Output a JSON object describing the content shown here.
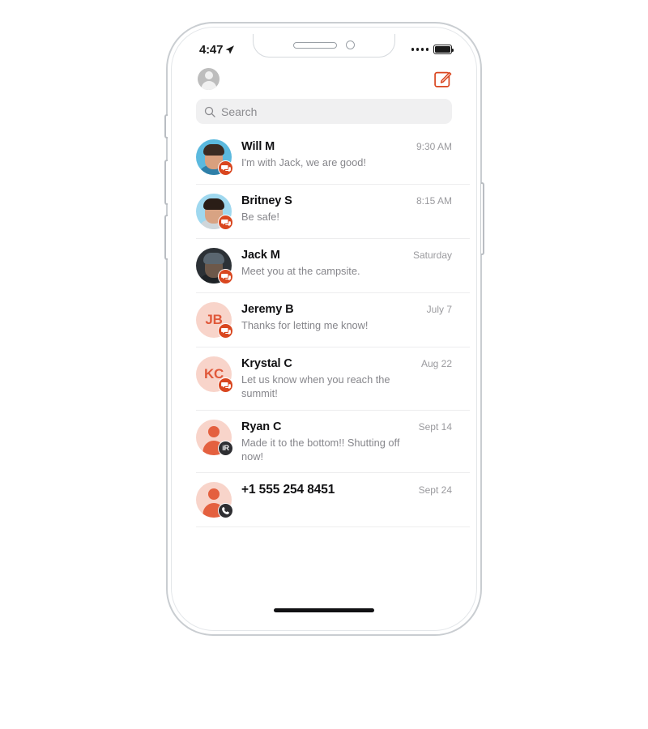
{
  "status_bar": {
    "time": "4:47",
    "location_icon": "location-arrow-icon",
    "signal_icon": "signal-dots-icon",
    "battery_icon": "battery-full-icon"
  },
  "header": {
    "profile_avatar": "profile-avatar-icon",
    "compose_icon": "compose-pencil-icon",
    "accent_color": "#d9461f"
  },
  "search": {
    "placeholder": "Search",
    "value": "",
    "icon": "search-icon"
  },
  "conversations": [
    {
      "name": "Will M",
      "preview": "I'm with Jack, we are good!",
      "time": "9:30 AM",
      "avatar_type": "photo",
      "badge": "chat-bubble-icon",
      "badge_style": "chat"
    },
    {
      "name": "Britney S",
      "preview": "Be safe!",
      "time": "8:15 AM",
      "avatar_type": "photo",
      "badge": "chat-bubble-icon",
      "badge_style": "chat"
    },
    {
      "name": "Jack M",
      "preview": "Meet you at the campsite.",
      "time": "Saturday",
      "avatar_type": "photo",
      "badge": "chat-bubble-icon",
      "badge_style": "chat"
    },
    {
      "name": "Jeremy B",
      "preview": "Thanks for letting me know!",
      "time": "July 7",
      "avatar_type": "initials",
      "initials": "JB",
      "badge": "chat-bubble-icon",
      "badge_style": "chat"
    },
    {
      "name": "Krystal C",
      "preview": "Let us know when you reach the summit!",
      "time": "Aug 22",
      "avatar_type": "initials",
      "initials": "KC",
      "badge": "chat-bubble-icon",
      "badge_style": "chat"
    },
    {
      "name": "Ryan C",
      "preview": "Made it to the bottom!! Shutting off now!",
      "time": "Sept 14",
      "avatar_type": "person",
      "badge": "ir-label-icon",
      "badge_label": "iR",
      "badge_style": "dark"
    },
    {
      "name": "+1 555 254 8451",
      "preview": "",
      "time": "Sept 24",
      "avatar_type": "person",
      "badge": "phone-handset-icon",
      "badge_style": "dark"
    }
  ],
  "device": {
    "notch_speaker": "earpiece-speaker",
    "notch_camera": "front-camera",
    "home_indicator": "home-indicator-bar",
    "buttons": [
      "silent-switch",
      "volume-up",
      "volume-down",
      "power"
    ]
  }
}
